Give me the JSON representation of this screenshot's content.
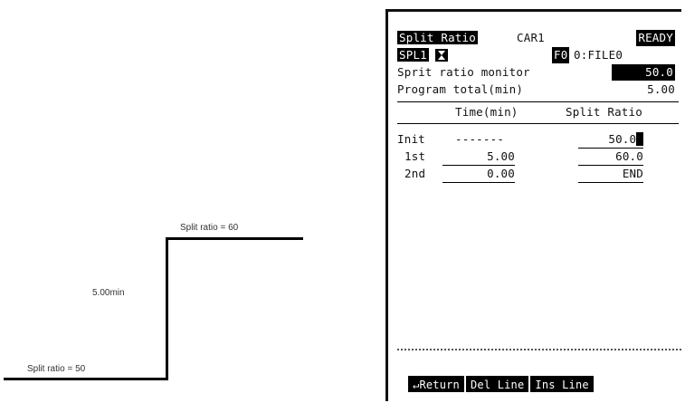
{
  "diagram": {
    "label_initial": "Split ratio = 50",
    "label_step": "Split ratio = 60",
    "label_time": "5.00min"
  },
  "screen": {
    "title": "Split Ratio",
    "carrier": "CAR1",
    "status": "READY",
    "mode_tag": "SPL1",
    "mode_icon": "hourglass-icon",
    "file_tag": "F0",
    "file_name": "0:FILE0",
    "monitor_label": "Sprit ratio monitor",
    "monitor_value": "50.0",
    "program_label": "Program total(min)",
    "program_value": "5.00",
    "table": {
      "headers": [
        "Time(min)",
        "Split Ratio"
      ],
      "rows": [
        {
          "step": "Init",
          "time": "-------",
          "ratio": "50.0"
        },
        {
          "step": "1st",
          "time": "5.00",
          "ratio": "60.0"
        },
        {
          "step": "2nd",
          "time": "0.00",
          "ratio": "END"
        }
      ]
    },
    "softkeys": {
      "return": "Return",
      "del_line": "Del Line",
      "ins_line": "Ins Line"
    }
  }
}
